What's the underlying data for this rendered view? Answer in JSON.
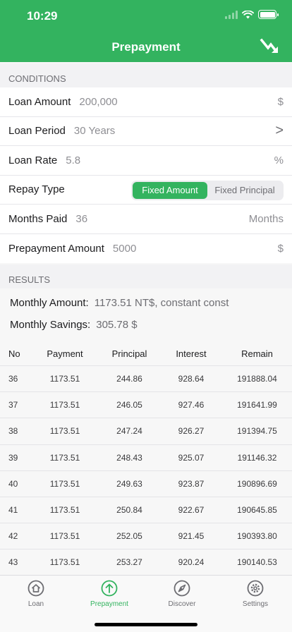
{
  "status": {
    "time": "10:29"
  },
  "nav": {
    "title": "Prepayment",
    "action_icon": "trend-down-arrow-icon"
  },
  "conditions": {
    "section_label": "CONDITIONS",
    "loan_amount": {
      "label": "Loan Amount",
      "value": "200,000",
      "suffix": "$"
    },
    "loan_period": {
      "label": "Loan Period",
      "value": "30 Years",
      "chevron": ">"
    },
    "loan_rate": {
      "label": "Loan Rate",
      "value": "5.8",
      "suffix": "%"
    },
    "repay_type": {
      "label": "Repay Type",
      "options": [
        "Fixed Amount",
        "Fixed Principal"
      ],
      "selected": "Fixed Amount"
    },
    "months_paid": {
      "label": "Months Paid",
      "value": "36",
      "suffix": "Months"
    },
    "prepayment_amount": {
      "label": "Prepayment Amount",
      "value": "5000",
      "suffix": "$"
    }
  },
  "results": {
    "section_label": "RESULTS",
    "monthly_amount": {
      "label": "Monthly Amount:",
      "value": "1173.51 NT$, constant const"
    },
    "monthly_savings": {
      "label": "Monthly Savings:",
      "value": "305.78 $"
    },
    "table": {
      "headers": [
        "No",
        "Payment",
        "Principal",
        "Interest",
        "Remain"
      ],
      "rows": [
        [
          "36",
          "1173.51",
          "244.86",
          "928.64",
          "191888.04"
        ],
        [
          "37",
          "1173.51",
          "246.05",
          "927.46",
          "191641.99"
        ],
        [
          "38",
          "1173.51",
          "247.24",
          "926.27",
          "191394.75"
        ],
        [
          "39",
          "1173.51",
          "248.43",
          "925.07",
          "191146.32"
        ],
        [
          "40",
          "1173.51",
          "249.63",
          "923.87",
          "190896.69"
        ],
        [
          "41",
          "1173.51",
          "250.84",
          "922.67",
          "190645.85"
        ],
        [
          "42",
          "1173.51",
          "252.05",
          "921.45",
          "190393.80"
        ],
        [
          "43",
          "1173.51",
          "253.27",
          "920.24",
          "190140.53"
        ]
      ]
    }
  },
  "tabbar": {
    "items": [
      {
        "label": "Loan",
        "icon": "home-icon"
      },
      {
        "label": "Prepayment",
        "icon": "up-arrow-circle-icon"
      },
      {
        "label": "Discover",
        "icon": "compass-icon"
      },
      {
        "label": "Settings",
        "icon": "gear-icon"
      }
    ],
    "active": "Prepayment"
  },
  "colors": {
    "accent": "#33b35f",
    "background": "#f7f7f7"
  }
}
